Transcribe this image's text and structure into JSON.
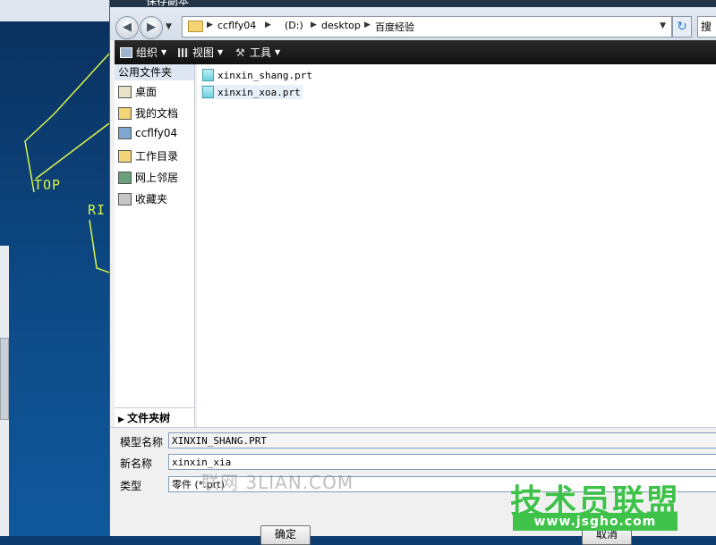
{
  "viewport": {
    "label_top": "TOP",
    "label_right": "RI",
    "line_color": "#d7f54a"
  },
  "dialog": {
    "title": "保存副本",
    "address": {
      "crumbs": [
        "ccflfy04",
        "(D:)",
        "desktop",
        "百度经验"
      ],
      "search_placeholder": "搜"
    },
    "toolbar": {
      "organize": "组织",
      "view": "视图",
      "tools": "工具"
    },
    "nav": {
      "section": "公用文件夹",
      "items": [
        {
          "label": "桌面",
          "icon": "desktop-icon"
        },
        {
          "label": "我的文档",
          "icon": "my-documents-icon"
        },
        {
          "label": "ccflfy04",
          "icon": "computer-icon"
        },
        {
          "label": "工作目录",
          "icon": "working-directory-icon"
        },
        {
          "label": "网上邻居",
          "icon": "network-icon"
        },
        {
          "label": "收藏夹",
          "icon": "favorites-icon"
        }
      ],
      "tree_label": "文件夹树"
    },
    "files": [
      {
        "name": "xinxin_shang.prt"
      },
      {
        "name": "xinxin_xoa.prt"
      }
    ],
    "fields": {
      "model_name_label": "模型名称",
      "model_name_value": "XINXIN_SHANG.PRT",
      "new_name_label": "新名称",
      "new_name_value": "xinxin_xia",
      "type_label": "类型",
      "type_value": "零件 (*.prt)"
    },
    "buttons": {
      "ok": "确定",
      "cancel": "取消"
    }
  },
  "watermarks": {
    "site1": "联网 3LIAN.COM",
    "site2_text": "技术员联盟",
    "site2_url": "www.jsgho.com"
  }
}
